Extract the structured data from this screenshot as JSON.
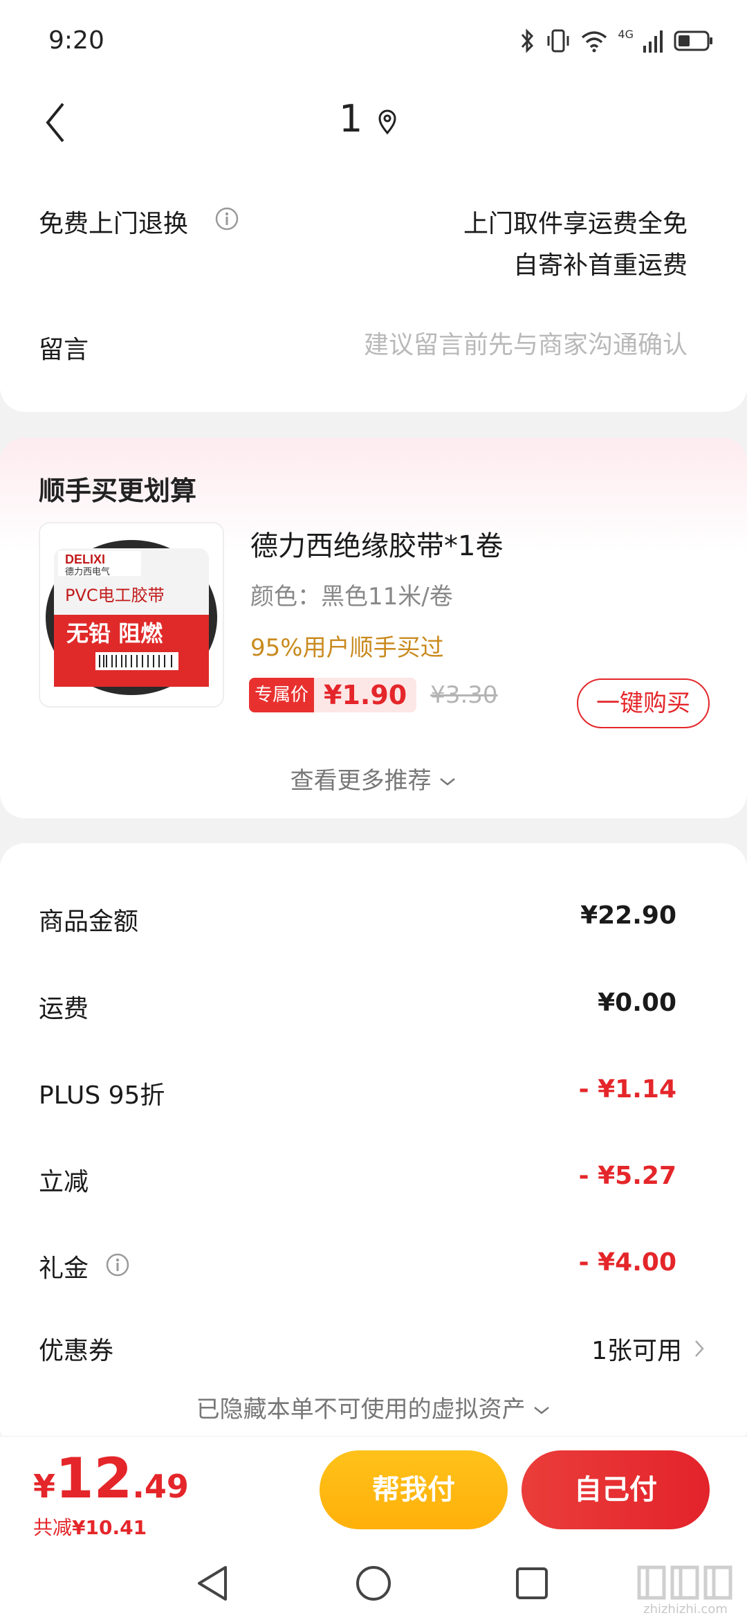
{
  "status_bar": {
    "time": "9:20",
    "network": "4G"
  },
  "nav": {
    "title": "1"
  },
  "return_row": {
    "label": "免费上门退换",
    "line1": "上门取件享运费全免",
    "line2": "自寄补首重运费"
  },
  "message_row": {
    "label": "留言",
    "placeholder": "建议留言前先与商家沟通确认"
  },
  "recommend": {
    "title": "顺手买更划算",
    "product": {
      "name": "德力西绝缘胶带*1卷",
      "spec": "颜色：黑色11米/卷",
      "popular": "95%用户顺手买过",
      "price_tag": "专属价",
      "price": "¥1.90",
      "orig_price": "¥3.30",
      "buy_label": "一键购买",
      "image_text": {
        "brand": "DELIXI",
        "brand_sub": "德力西电气",
        "line1": "PVC电工胶带",
        "line2": "无铅 阻燃"
      }
    },
    "more_label": "查看更多推荐"
  },
  "summary": {
    "rows": [
      {
        "label": "商品金额",
        "amount": "¥22.90"
      },
      {
        "label": "运费",
        "amount": "¥0.00"
      },
      {
        "label": "PLUS 95折",
        "amount": "- ¥1.14"
      },
      {
        "label": "立减",
        "amount": "- ¥5.27"
      },
      {
        "label": "礼金",
        "amount": "- ¥4.00"
      },
      {
        "label": "优惠券",
        "amount": "1张可用"
      }
    ],
    "hidden_assets": "已隐藏本单不可使用的虚拟资产"
  },
  "pay_bar": {
    "currency": "¥",
    "total_int": "12",
    "total_dec": ".49",
    "saved_label": "共减",
    "saved_amount": "¥10.41",
    "help_pay_label": "帮我付",
    "self_pay_label": "自己付"
  },
  "watermark": {
    "text": "zhizhizhi.com"
  },
  "colors": {
    "accent_red": "#e4262a",
    "accent_yellow": "#ffb00a",
    "popular_gold": "#c98a1e"
  }
}
